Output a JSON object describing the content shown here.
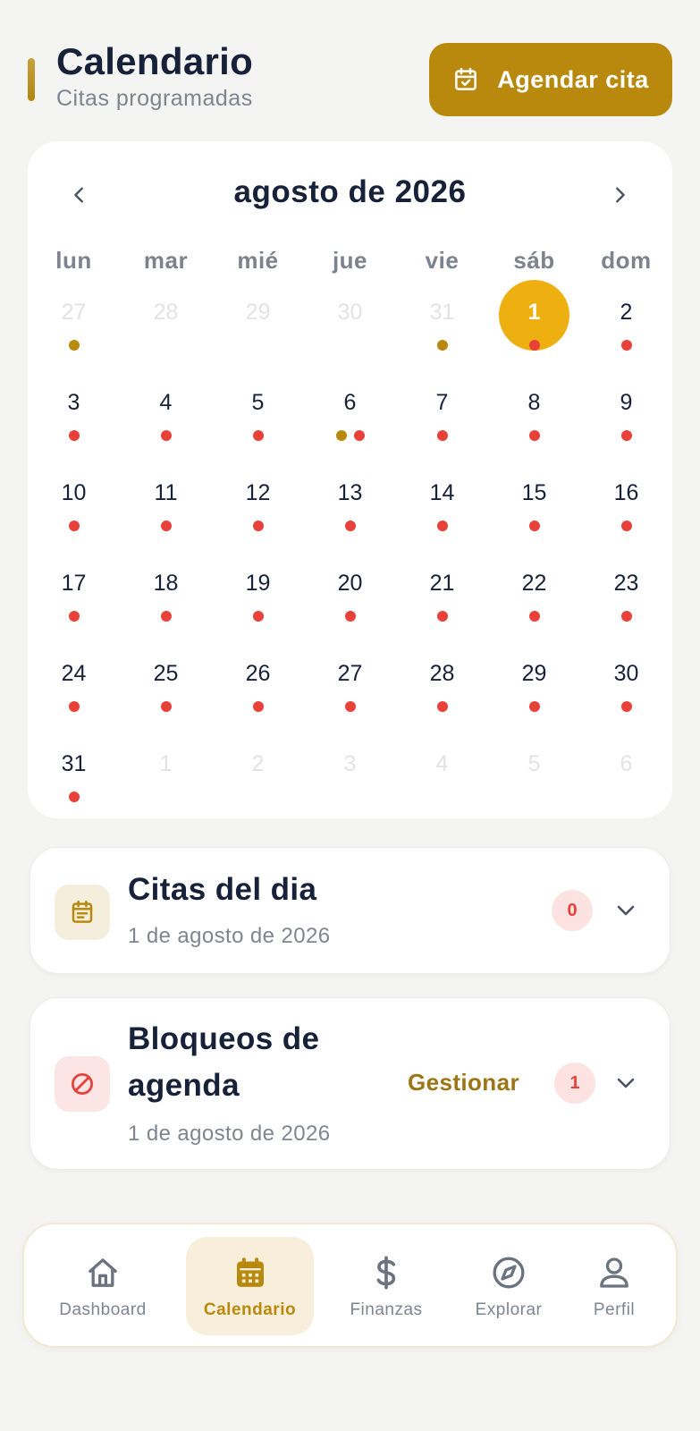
{
  "header": {
    "title": "Calendario",
    "subtitle": "Citas programadas",
    "agendar_label": "Agendar cita"
  },
  "calendar": {
    "month_label": "agosto de 2026",
    "weekdays": [
      "lun",
      "mar",
      "mié",
      "jue",
      "vie",
      "sáb",
      "dom"
    ],
    "selected_day": "1",
    "days": [
      {
        "label": "27",
        "muted": true,
        "dots": [
          "gold"
        ]
      },
      {
        "label": "28",
        "muted": true,
        "dots": []
      },
      {
        "label": "29",
        "muted": true,
        "dots": []
      },
      {
        "label": "30",
        "muted": true,
        "dots": []
      },
      {
        "label": "31",
        "muted": true,
        "dots": [
          "gold"
        ]
      },
      {
        "label": "1",
        "muted": false,
        "selected": true,
        "dots": [
          "red"
        ]
      },
      {
        "label": "2",
        "muted": false,
        "dots": [
          "red"
        ]
      },
      {
        "label": "3",
        "muted": false,
        "dots": [
          "red"
        ]
      },
      {
        "label": "4",
        "muted": false,
        "dots": [
          "red"
        ]
      },
      {
        "label": "5",
        "muted": false,
        "dots": [
          "red"
        ]
      },
      {
        "label": "6",
        "muted": false,
        "dots": [
          "gold",
          "red"
        ]
      },
      {
        "label": "7",
        "muted": false,
        "dots": [
          "red"
        ]
      },
      {
        "label": "8",
        "muted": false,
        "dots": [
          "red"
        ]
      },
      {
        "label": "9",
        "muted": false,
        "dots": [
          "red"
        ]
      },
      {
        "label": "10",
        "muted": false,
        "dots": [
          "red"
        ]
      },
      {
        "label": "11",
        "muted": false,
        "dots": [
          "red"
        ]
      },
      {
        "label": "12",
        "muted": false,
        "dots": [
          "red"
        ]
      },
      {
        "label": "13",
        "muted": false,
        "dots": [
          "red"
        ]
      },
      {
        "label": "14",
        "muted": false,
        "dots": [
          "red"
        ]
      },
      {
        "label": "15",
        "muted": false,
        "dots": [
          "red"
        ]
      },
      {
        "label": "16",
        "muted": false,
        "dots": [
          "red"
        ]
      },
      {
        "label": "17",
        "muted": false,
        "dots": [
          "red"
        ]
      },
      {
        "label": "18",
        "muted": false,
        "dots": [
          "red"
        ]
      },
      {
        "label": "19",
        "muted": false,
        "dots": [
          "red"
        ]
      },
      {
        "label": "20",
        "muted": false,
        "dots": [
          "red"
        ]
      },
      {
        "label": "21",
        "muted": false,
        "dots": [
          "red"
        ]
      },
      {
        "label": "22",
        "muted": false,
        "dots": [
          "red"
        ]
      },
      {
        "label": "23",
        "muted": false,
        "dots": [
          "red"
        ]
      },
      {
        "label": "24",
        "muted": false,
        "dots": [
          "red"
        ]
      },
      {
        "label": "25",
        "muted": false,
        "dots": [
          "red"
        ]
      },
      {
        "label": "26",
        "muted": false,
        "dots": [
          "red"
        ]
      },
      {
        "label": "27",
        "muted": false,
        "dots": [
          "red"
        ]
      },
      {
        "label": "28",
        "muted": false,
        "dots": [
          "red"
        ]
      },
      {
        "label": "29",
        "muted": false,
        "dots": [
          "red"
        ]
      },
      {
        "label": "30",
        "muted": false,
        "dots": [
          "red"
        ]
      },
      {
        "label": "31",
        "muted": false,
        "dots": [
          "red"
        ]
      },
      {
        "label": "1",
        "muted": true,
        "dots": []
      },
      {
        "label": "2",
        "muted": true,
        "dots": []
      },
      {
        "label": "3",
        "muted": true,
        "dots": []
      },
      {
        "label": "4",
        "muted": true,
        "dots": []
      },
      {
        "label": "5",
        "muted": true,
        "dots": []
      },
      {
        "label": "6",
        "muted": true,
        "dots": []
      }
    ]
  },
  "citas_card": {
    "title": "Citas del dia",
    "date": "1 de agosto de 2026",
    "count": "0"
  },
  "bloqueos_card": {
    "title_line1": "Bloqueos de",
    "title_line2": "agenda",
    "date": "1 de agosto de 2026",
    "manage_label": "Gestionar",
    "count": "1"
  },
  "bottom_nav": {
    "items": [
      {
        "label": "Dashboard",
        "icon": "home-icon",
        "active": false
      },
      {
        "label": "Calendario",
        "icon": "calendar-icon",
        "active": true
      },
      {
        "label": "Finanzas",
        "icon": "dollar-icon",
        "active": false
      },
      {
        "label": "Explorar",
        "icon": "compass-icon",
        "active": false
      },
      {
        "label": "Perfil",
        "icon": "user-icon",
        "active": false
      }
    ]
  },
  "colors": {
    "accent": "#b8890c",
    "selected_day": "#eeb010",
    "event_dot": "#e8413a",
    "block_dot": "#b8890c"
  }
}
